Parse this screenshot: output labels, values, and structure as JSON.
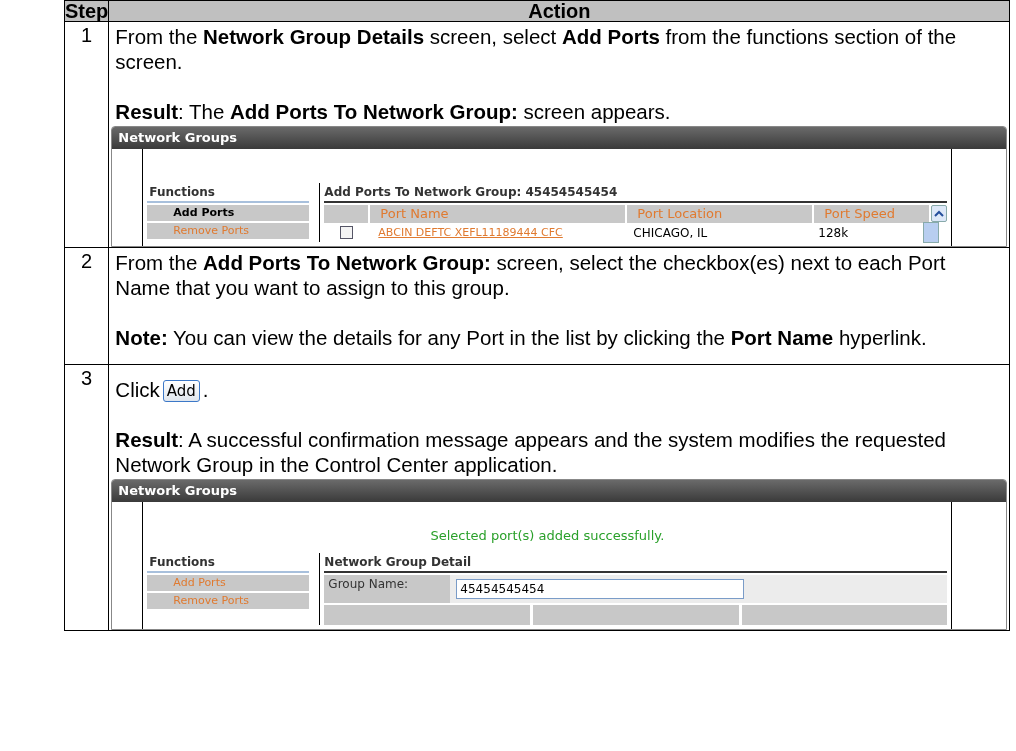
{
  "columns": [
    "Step",
    "Action"
  ],
  "rows": [
    {
      "step": "1",
      "paragraphs": [
        {
          "kind": "text",
          "text": "From the **Network Group Details** screen, select **Add Ports** from the functions section of the screen."
        },
        {
          "kind": "text",
          "text": "**Result**:  The **Add Ports To Network Group:** screen appears."
        }
      ],
      "screenshot": {
        "kind": "add_ports",
        "title": "Network Groups",
        "functions_heading": "Functions",
        "functions": [
          {
            "label": "Add Ports",
            "selected": true
          },
          {
            "label": "Remove Ports",
            "selected": false
          }
        ],
        "panel_title": "Add Ports To Network Group: 45454545454",
        "columns": [
          "Port Name",
          "Port Location",
          "Port Speed"
        ],
        "ports": [
          {
            "checked": false,
            "name": "ABCIN DEFTC XEFL11189444 CFC",
            "location": "CHICAGO, IL",
            "speed": "128k"
          }
        ]
      }
    },
    {
      "step": "2",
      "paragraphs": [
        {
          "kind": "text",
          "text": "From the **Add Ports To Network Group:** screen, select the checkbox(es) next to each Port Name that you want to assign to this group."
        },
        {
          "kind": "text",
          "text": "**Note:**  You can view the details for any Port in the list by clicking the **Port Name** hyperlink."
        }
      ]
    },
    {
      "step": "3",
      "paragraphs": [
        {
          "kind": "click",
          "text": "Click",
          "button": "Add",
          "after": "."
        },
        {
          "kind": "text",
          "text": "**Result**: A successful confirmation message appears and the system modifies the requested Network Group in the Control Center application."
        }
      ],
      "screenshot": {
        "kind": "detail",
        "title": "Network Groups",
        "message": "Selected port(s) added successfully.",
        "functions_heading": "Functions",
        "functions": [
          {
            "label": "Add Ports",
            "selected": false
          },
          {
            "label": "Remove Ports",
            "selected": false
          }
        ],
        "panel_title": "Network Group Detail",
        "field_label": "Group Name:",
        "field_value": "45454545454"
      }
    }
  ]
}
